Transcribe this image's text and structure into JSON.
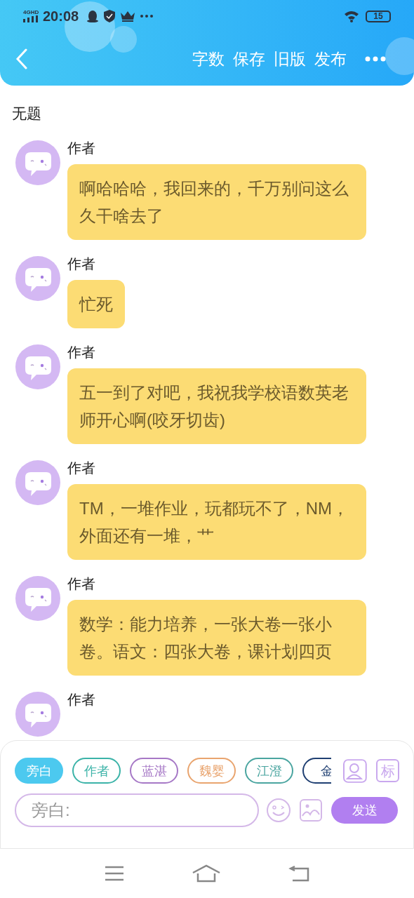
{
  "status_bar": {
    "network": "4G",
    "network_tag": "HD",
    "time": "20:08",
    "battery": "15"
  },
  "toolbar": {
    "actions": [
      "字数",
      "保存",
      "旧版",
      "发布"
    ]
  },
  "title": "无题",
  "messages": [
    {
      "author": "作者",
      "text": "啊哈哈哈，我回来的，千万别问这么久干啥去了"
    },
    {
      "author": "作者",
      "text": "忙死"
    },
    {
      "author": "作者",
      "text": "五一到了对吧，我祝我学校语数英老师开心啊(咬牙切齿)"
    },
    {
      "author": "作者",
      "text": "TM，一堆作业，玩都玩不了，NM，外面还有一堆，艹"
    },
    {
      "author": "作者",
      "text": "数学：能力培养，一张大卷一张小卷。语文：四张大卷，课计划四页"
    },
    {
      "author": "作者"
    }
  ],
  "roles": [
    {
      "label": "旁白",
      "selected": true,
      "color": "#4cc9ef"
    },
    {
      "label": "作者",
      "selected": false,
      "color": "#3bb3a8"
    },
    {
      "label": "蓝湛",
      "selected": false,
      "color": "#a678c6"
    },
    {
      "label": "魏婴",
      "selected": false,
      "color": "#e9a46e"
    },
    {
      "label": "江澄",
      "selected": false,
      "color": "#4aa5a0"
    },
    {
      "label": "金",
      "selected": false,
      "color": "#1f3f72"
    }
  ],
  "mark_button": "标",
  "input": {
    "placeholder": "旁白:"
  },
  "send_button": "发送"
}
